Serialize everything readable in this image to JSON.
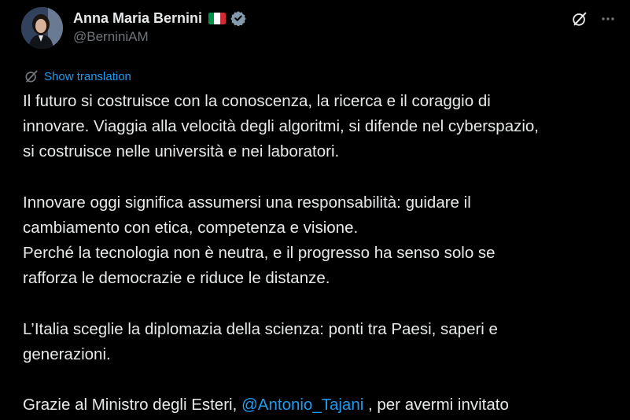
{
  "author": {
    "display_name": "Anna Maria Bernini",
    "handle": "@BerniniAM",
    "flag_icon": "italy-flag-icon",
    "badge_icon": "verified-badge-icon",
    "flag_colors": [
      "#009246",
      "#ffffff",
      "#ce2b37"
    ],
    "badge_color": "#829aab"
  },
  "actions": {
    "grok_icon": "grok-icon",
    "more_icon": "more-horizontal-icon"
  },
  "translation": {
    "label": "Show translation",
    "icon": "grok-icon"
  },
  "tweet": {
    "paragraphs": [
      {
        "lines": [
          "Il futuro si costruisce con la conoscenza, la ricerca e il coraggio di",
          "innovare. Viaggia alla velocità degli algoritmi, si difende nel cyberspazio,",
          "si costruisce nelle università e nei laboratori."
        ]
      },
      {
        "lines": [
          "Innovare oggi significa assumersi una responsabilità: guidare il",
          "cambiamento con etica, competenza e visione.",
          "Perché la tecnologia non è neutra, e il progresso ha senso solo se",
          "rafforza le democrazie e riduce le distanze."
        ]
      },
      {
        "lines": [
          "L’Italia sceglie la diplomazia della scienza: ponti tra Paesi, saperi e",
          "generazioni."
        ]
      }
    ],
    "last_line": {
      "before": "Grazie al Ministro degli Esteri, ",
      "mention": "@Antonio_Tajani",
      "after": " , per avermi invitato"
    }
  },
  "colors": {
    "background": "#000000",
    "text": "#e7e9ea",
    "secondary_text": "#71767b",
    "link": "#1d9bf0"
  }
}
